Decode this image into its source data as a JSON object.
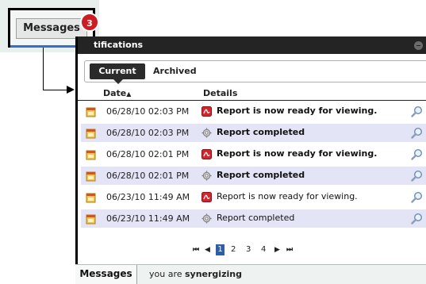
{
  "callout": {
    "button_label": "Messages",
    "badge_count": "3"
  },
  "panel": {
    "title": "tifications",
    "tabs": [
      {
        "label": "Current",
        "selected": true
      },
      {
        "label": "Archived",
        "selected": false
      }
    ],
    "columns": {
      "date": "Date",
      "date_sort": "▲",
      "details": "Details"
    },
    "rows": [
      {
        "date": "06/28/10 02:03 PM",
        "type_icon": "pdf-icon",
        "detail": "Report is now ready for viewing.",
        "bold": true
      },
      {
        "date": "06/28/10 02:03 PM",
        "type_icon": "gear-icon",
        "detail": "Report completed",
        "bold": true
      },
      {
        "date": "06/28/10 02:01 PM",
        "type_icon": "pdf-icon",
        "detail": "Report is now ready for viewing.",
        "bold": true
      },
      {
        "date": "06/28/10 02:01 PM",
        "type_icon": "gear-icon",
        "detail": "Report completed",
        "bold": true
      },
      {
        "date": "06/23/10 11:49 AM",
        "type_icon": "pdf-icon",
        "detail": "Report is now ready for viewing.",
        "bold": false
      },
      {
        "date": "06/23/10 11:49 AM",
        "type_icon": "gear-icon",
        "detail": "Report completed",
        "bold": false
      }
    ],
    "pager": {
      "first": "⏮",
      "prev": "◀",
      "pages": [
        "1",
        "2",
        "3",
        "4"
      ],
      "current": "1",
      "next": "▶",
      "last": "⏭"
    }
  },
  "bottom": {
    "tab_label": "Messages",
    "status_prefix": "you are ",
    "status_bold": "synergizing"
  },
  "colors": {
    "titlebar": "#242424",
    "row_alt": "#e4e4f7",
    "badge": "#cc1d22",
    "page_current": "#2f5ea8"
  }
}
